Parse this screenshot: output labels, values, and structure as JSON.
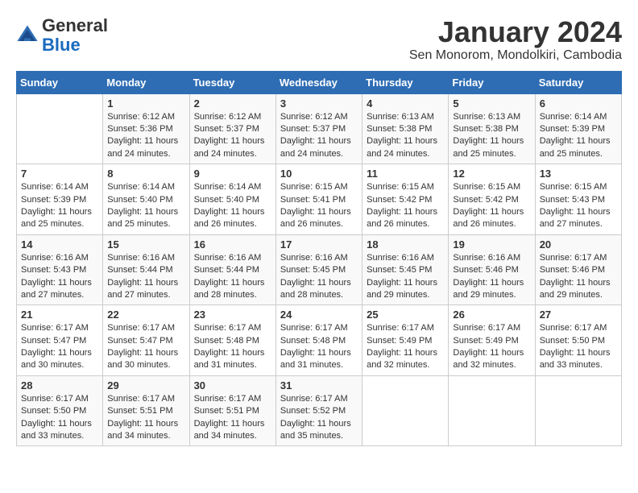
{
  "header": {
    "logo_general": "General",
    "logo_blue": "Blue",
    "month": "January 2024",
    "location": "Sen Monorom, Mondolkiri, Cambodia"
  },
  "weekdays": [
    "Sunday",
    "Monday",
    "Tuesday",
    "Wednesday",
    "Thursday",
    "Friday",
    "Saturday"
  ],
  "weeks": [
    [
      {
        "day": "",
        "info": ""
      },
      {
        "day": "1",
        "info": "Sunrise: 6:12 AM\nSunset: 5:36 PM\nDaylight: 11 hours and 24 minutes."
      },
      {
        "day": "2",
        "info": "Sunrise: 6:12 AM\nSunset: 5:37 PM\nDaylight: 11 hours and 24 minutes."
      },
      {
        "day": "3",
        "info": "Sunrise: 6:12 AM\nSunset: 5:37 PM\nDaylight: 11 hours and 24 minutes."
      },
      {
        "day": "4",
        "info": "Sunrise: 6:13 AM\nSunset: 5:38 PM\nDaylight: 11 hours and 24 minutes."
      },
      {
        "day": "5",
        "info": "Sunrise: 6:13 AM\nSunset: 5:38 PM\nDaylight: 11 hours and 25 minutes."
      },
      {
        "day": "6",
        "info": "Sunrise: 6:14 AM\nSunset: 5:39 PM\nDaylight: 11 hours and 25 minutes."
      }
    ],
    [
      {
        "day": "7",
        "info": "Sunrise: 6:14 AM\nSunset: 5:39 PM\nDaylight: 11 hours and 25 minutes."
      },
      {
        "day": "8",
        "info": "Sunrise: 6:14 AM\nSunset: 5:40 PM\nDaylight: 11 hours and 25 minutes."
      },
      {
        "day": "9",
        "info": "Sunrise: 6:14 AM\nSunset: 5:40 PM\nDaylight: 11 hours and 26 minutes."
      },
      {
        "day": "10",
        "info": "Sunrise: 6:15 AM\nSunset: 5:41 PM\nDaylight: 11 hours and 26 minutes."
      },
      {
        "day": "11",
        "info": "Sunrise: 6:15 AM\nSunset: 5:42 PM\nDaylight: 11 hours and 26 minutes."
      },
      {
        "day": "12",
        "info": "Sunrise: 6:15 AM\nSunset: 5:42 PM\nDaylight: 11 hours and 26 minutes."
      },
      {
        "day": "13",
        "info": "Sunrise: 6:15 AM\nSunset: 5:43 PM\nDaylight: 11 hours and 27 minutes."
      }
    ],
    [
      {
        "day": "14",
        "info": "Sunrise: 6:16 AM\nSunset: 5:43 PM\nDaylight: 11 hours and 27 minutes."
      },
      {
        "day": "15",
        "info": "Sunrise: 6:16 AM\nSunset: 5:44 PM\nDaylight: 11 hours and 27 minutes."
      },
      {
        "day": "16",
        "info": "Sunrise: 6:16 AM\nSunset: 5:44 PM\nDaylight: 11 hours and 28 minutes."
      },
      {
        "day": "17",
        "info": "Sunrise: 6:16 AM\nSunset: 5:45 PM\nDaylight: 11 hours and 28 minutes."
      },
      {
        "day": "18",
        "info": "Sunrise: 6:16 AM\nSunset: 5:45 PM\nDaylight: 11 hours and 29 minutes."
      },
      {
        "day": "19",
        "info": "Sunrise: 6:16 AM\nSunset: 5:46 PM\nDaylight: 11 hours and 29 minutes."
      },
      {
        "day": "20",
        "info": "Sunrise: 6:17 AM\nSunset: 5:46 PM\nDaylight: 11 hours and 29 minutes."
      }
    ],
    [
      {
        "day": "21",
        "info": "Sunrise: 6:17 AM\nSunset: 5:47 PM\nDaylight: 11 hours and 30 minutes."
      },
      {
        "day": "22",
        "info": "Sunrise: 6:17 AM\nSunset: 5:47 PM\nDaylight: 11 hours and 30 minutes."
      },
      {
        "day": "23",
        "info": "Sunrise: 6:17 AM\nSunset: 5:48 PM\nDaylight: 11 hours and 31 minutes."
      },
      {
        "day": "24",
        "info": "Sunrise: 6:17 AM\nSunset: 5:48 PM\nDaylight: 11 hours and 31 minutes."
      },
      {
        "day": "25",
        "info": "Sunrise: 6:17 AM\nSunset: 5:49 PM\nDaylight: 11 hours and 32 minutes."
      },
      {
        "day": "26",
        "info": "Sunrise: 6:17 AM\nSunset: 5:49 PM\nDaylight: 11 hours and 32 minutes."
      },
      {
        "day": "27",
        "info": "Sunrise: 6:17 AM\nSunset: 5:50 PM\nDaylight: 11 hours and 33 minutes."
      }
    ],
    [
      {
        "day": "28",
        "info": "Sunrise: 6:17 AM\nSunset: 5:50 PM\nDaylight: 11 hours and 33 minutes."
      },
      {
        "day": "29",
        "info": "Sunrise: 6:17 AM\nSunset: 5:51 PM\nDaylight: 11 hours and 34 minutes."
      },
      {
        "day": "30",
        "info": "Sunrise: 6:17 AM\nSunset: 5:51 PM\nDaylight: 11 hours and 34 minutes."
      },
      {
        "day": "31",
        "info": "Sunrise: 6:17 AM\nSunset: 5:52 PM\nDaylight: 11 hours and 35 minutes."
      },
      {
        "day": "",
        "info": ""
      },
      {
        "day": "",
        "info": ""
      },
      {
        "day": "",
        "info": ""
      }
    ]
  ]
}
